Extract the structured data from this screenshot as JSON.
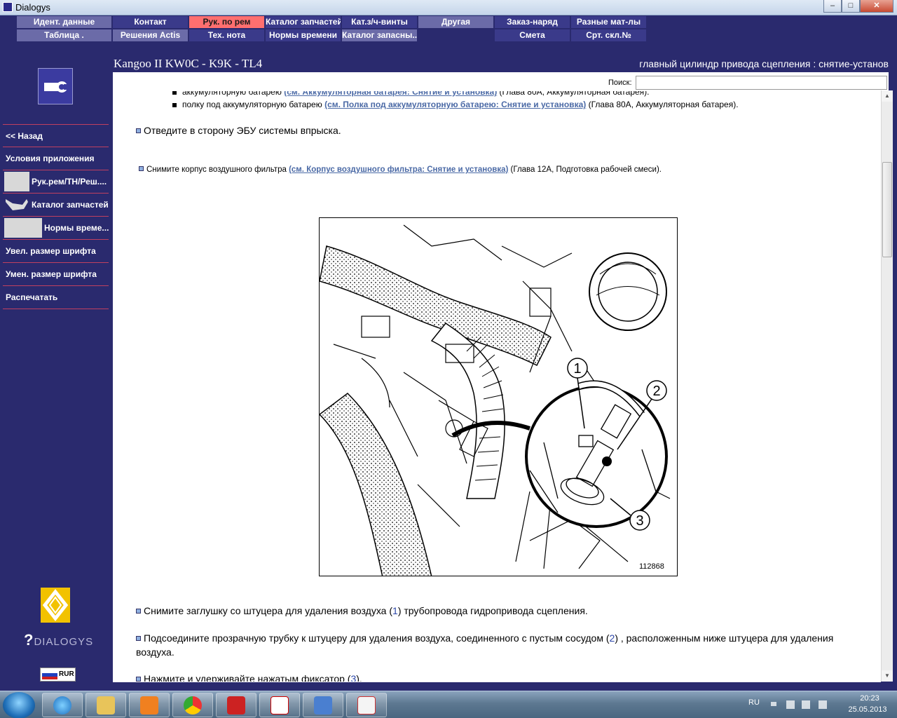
{
  "window": {
    "title": "Dialogys",
    "min": "–",
    "max": "□",
    "close": "✕"
  },
  "menu": {
    "row1": [
      "Идент. данные",
      "Контакт",
      "Рук. по рем",
      "Каталог запчастей",
      "Кат.з/ч-винты",
      "Другая",
      "Заказ-наряд",
      "Разные мат-лы"
    ],
    "row2": [
      "Таблица .",
      "Решения Actis",
      "Тех. нота",
      "Нормы времени",
      "Каталог запасны...",
      "Смета",
      "Срт. скл.№"
    ]
  },
  "header": {
    "vehicle": "Kangoo II KW0C - K9K - TL4",
    "topic": "главный цилиндр привода сцепления : снятие-установ"
  },
  "search": {
    "label": "Поиск:",
    "value": ""
  },
  "sidebar": {
    "items": [
      "<< Назад",
      "Условия приложения",
      "Рук.рем/ТН/Реш....",
      "Каталог запчастей",
      "Нормы време...",
      "Увел. размер шрифта",
      "Умен. размер шрифта",
      "Распечатать"
    ],
    "brand": "DIALOGYS",
    "currency": "RUR"
  },
  "content": {
    "list1_a": "аккумуляторную батарею",
    "list1_a_link": "(см. Аккумуляторная батарея: Снятие и установка)",
    "list1_a_tail": "(Глава 80А, Аккумуляторная батарея).",
    "list1_b": "полку под аккумуляторную батарею",
    "list1_b_link": "(см. Полка под аккумуляторную батарею: Снятие и установка)",
    "list1_b_tail": "(Глава 80А, Аккумуляторная батарея).",
    "step_ecu": "Отведите в сторону ЭБУ системы впрыска.",
    "step_filter": "Снимите корпус воздушного фильтра",
    "step_filter_link": "(см. Корпус воздушного фильтра: Снятие и установка)",
    "step_filter_tail": "(Глава 12А, Подготовка рабочей смеси).",
    "figure_code": "112868",
    "callouts": [
      "1",
      "2",
      "3"
    ],
    "step_cap_pre": "Снимите заглушку со штуцера для удаления воздуха (",
    "step_cap_num": "1",
    "step_cap_post": ") трубопровода гидропривода сцепления.",
    "step_tube_pre": "Подсоедините прозрачную трубку к штуцеру для удаления воздуха, соединенного с пустым сосудом (",
    "step_tube_num": "2",
    "step_tube_post": ") , расположенным ниже штуцера для удаления воздуха.",
    "step_press_pre": "Нажмите и удерживайте нажатым фиксатор (",
    "step_press_num": "3",
    "step_press_post": ")."
  },
  "taskbar": {
    "lang": "RU",
    "time": "20:23",
    "date": "25.05.2013"
  }
}
